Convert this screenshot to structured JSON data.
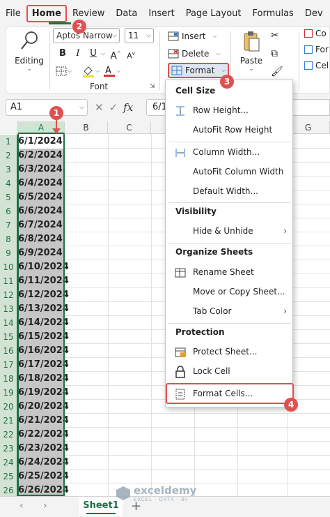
{
  "menu": [
    "File",
    "Home",
    "Review",
    "Data",
    "Insert",
    "Page Layout",
    "Formulas",
    "Dev"
  ],
  "ribbon": {
    "editing_label": "Editing",
    "font_name": "Aptos Narrow",
    "font_size": "11",
    "font_group_label": "Font",
    "bold": "B",
    "italic": "I",
    "underline": "U",
    "insert_label": "Insert",
    "delete_label": "Delete",
    "format_label": "Format",
    "paste_label": "Paste",
    "co_items": [
      "Co",
      "For",
      "Cel"
    ]
  },
  "formula_bar": {
    "name_box": "A1",
    "fx": "fx",
    "value": "6/1"
  },
  "grid": {
    "col_headers": [
      "A",
      "B",
      "C",
      "D",
      "E",
      "F",
      "G"
    ],
    "rows": [
      {
        "n": "1",
        "a": "6/1/2024"
      },
      {
        "n": "2",
        "a": "6/2/2024"
      },
      {
        "n": "3",
        "a": "6/3/2024"
      },
      {
        "n": "4",
        "a": "6/4/2024"
      },
      {
        "n": "5",
        "a": "6/5/2024"
      },
      {
        "n": "6",
        "a": "6/6/2024"
      },
      {
        "n": "7",
        "a": "6/7/2024"
      },
      {
        "n": "8",
        "a": "6/8/2024"
      },
      {
        "n": "9",
        "a": "6/9/2024"
      },
      {
        "n": "10",
        "a": "6/10/2024"
      },
      {
        "n": "11",
        "a": "6/11/2024"
      },
      {
        "n": "12",
        "a": "6/12/2024"
      },
      {
        "n": "13",
        "a": "6/13/2024"
      },
      {
        "n": "14",
        "a": "6/14/2024"
      },
      {
        "n": "15",
        "a": "6/15/2024"
      },
      {
        "n": "16",
        "a": "6/16/2024"
      },
      {
        "n": "17",
        "a": "6/17/2024"
      },
      {
        "n": "18",
        "a": "6/18/2024"
      },
      {
        "n": "19",
        "a": "6/19/2024"
      },
      {
        "n": "20",
        "a": "6/20/2024"
      },
      {
        "n": "21",
        "a": "6/21/2024"
      },
      {
        "n": "22",
        "a": "6/22/2024"
      },
      {
        "n": "23",
        "a": "6/23/2024"
      },
      {
        "n": "24",
        "a": "6/24/2024"
      },
      {
        "n": "25",
        "a": "6/25/2024"
      },
      {
        "n": "26",
        "a": "6/26/2024"
      }
    ]
  },
  "format_menu": {
    "cell_size_header": "Cell Size",
    "row_height": "Row Height...",
    "autofit_row_height": "AutoFit Row Height",
    "column_width": "Column Width...",
    "autofit_column_width": "AutoFit Column Width",
    "default_width": "Default Width...",
    "visibility_header": "Visibility",
    "hide_unhide": "Hide & Unhide",
    "organize_header": "Organize Sheets",
    "rename_sheet": "Rename Sheet",
    "move_copy_sheet": "Move or Copy Sheet...",
    "tab_color": "Tab Color",
    "protection_header": "Protection",
    "protect_sheet": "Protect Sheet...",
    "lock_cell": "Lock Cell",
    "format_cells": "Format Cells..."
  },
  "sheets": {
    "active": "Sheet1",
    "add": "+"
  },
  "watermark": {
    "name": "exceldemy",
    "sub": "EXCEL · DATA · BI"
  },
  "callouts": [
    "1",
    "2",
    "3",
    "4"
  ],
  "colors": {
    "accent_green": "#1e7145",
    "callout_red": "#e05050"
  }
}
